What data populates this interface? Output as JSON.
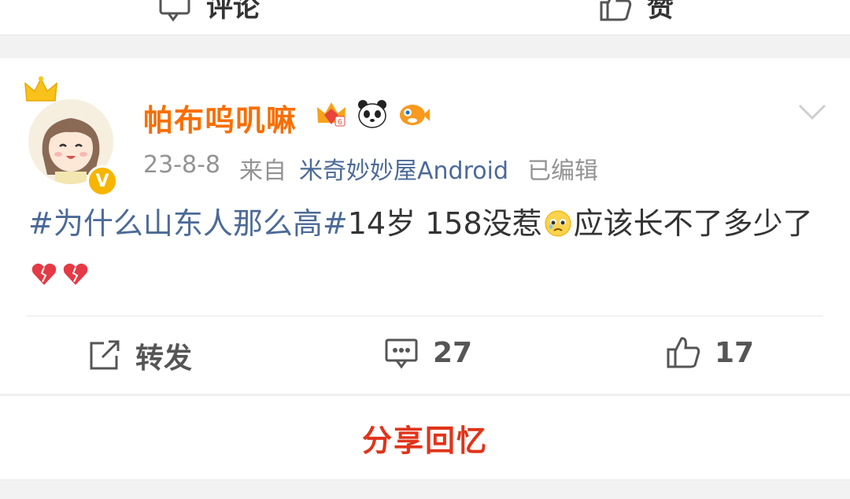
{
  "previous_post": {
    "comment_label": "评论",
    "like_label": "赞"
  },
  "post": {
    "username": "帕布呜叽嘛",
    "badges": [
      "crown-badge-icon",
      "panda-badge-icon",
      "fish-badge-icon"
    ],
    "date": "23-8-8",
    "from_label": "来自",
    "source": "米奇妙妙屋Android",
    "edited": "已编辑",
    "topic": "#为什么山东人那么高#",
    "text_part1": "14岁 158没惹",
    "text_part2": "应该长不了多少了",
    "emojis": [
      "pleading-face-emoji",
      "broken-heart-emoji",
      "broken-heart-emoji"
    ],
    "verified_badge": "V"
  },
  "actions": {
    "repost_label": "转发",
    "comment_count": "27",
    "like_count": "17"
  },
  "share_memory": "分享回忆",
  "colors": {
    "username": "#f86e00",
    "link": "#4c6a97",
    "share": "#e0341a",
    "verified": "#f7b500"
  }
}
